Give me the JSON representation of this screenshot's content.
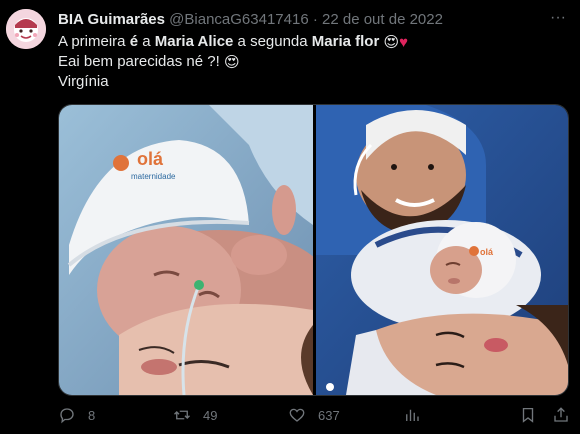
{
  "author": {
    "name": "BIA Guimarães",
    "handle": "@BiancaG63417416",
    "separator": "·",
    "date": "22 de out de 2022"
  },
  "tweet": {
    "line1_part1": "A primeira ",
    "line1_bold1": "é",
    "line1_part2": " a ",
    "line1_bold2": "Maria Alice",
    "line1_part3": " a segunda ",
    "line1_bold3": "Maria flor",
    "line1_emoji1": "😍",
    "line1_emoji2": "♥",
    "line2_text": "Eai bem parecidas né ?! ",
    "line2_emoji": "😍",
    "line3_text": "Virgínia"
  },
  "media": {
    "left_cap_text": "olá",
    "left_cap_subtext": "maternidade",
    "right_cap_text": "olá"
  },
  "actions": {
    "replies": "8",
    "retweets": "49",
    "likes": "637"
  },
  "icons": {
    "more": "more-icon",
    "reply": "reply-icon",
    "retweet": "retweet-icon",
    "like": "heart-icon",
    "views": "views-icon",
    "bookmark": "bookmark-icon",
    "share": "share-icon"
  },
  "colors": {
    "background": "#000000",
    "text": "#e7e9ea",
    "muted": "#71767b",
    "heart": "#e0245e"
  }
}
